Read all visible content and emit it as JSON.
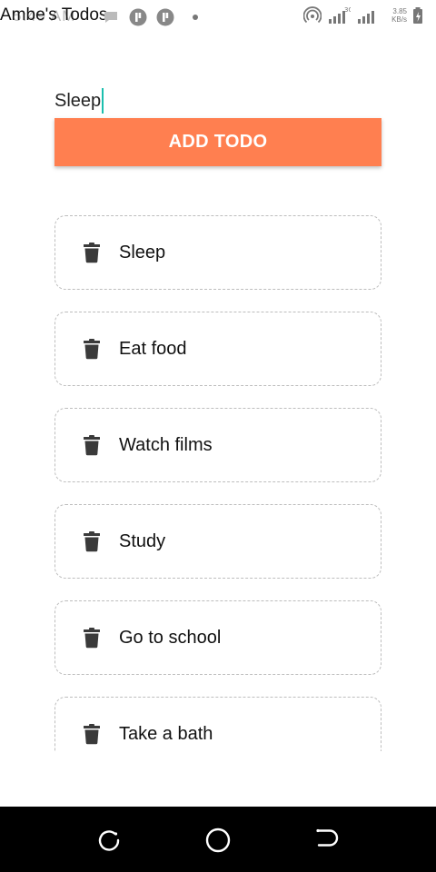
{
  "status_bar": {
    "time": "5:49 AM",
    "app_title": "Ambe's Todos",
    "network_type": "3G",
    "net_speed_value": "3.85",
    "net_speed_unit": "KB/s"
  },
  "input": {
    "value": "Sleep"
  },
  "add_button": {
    "label": "ADD TODO"
  },
  "todos": [
    "Sleep",
    "Eat food",
    "Watch films",
    "Study",
    "Go to school",
    "Take a bath"
  ],
  "colors": {
    "accent": "#ff7f50",
    "caret": "#1bbfae",
    "item_border": "#bdbdbd",
    "nav_bar": "#000000"
  },
  "icons": {
    "todo": "trash-icon",
    "nav_back": "back-icon",
    "nav_home": "home-icon",
    "nav_recent": "recent-apps-icon"
  }
}
